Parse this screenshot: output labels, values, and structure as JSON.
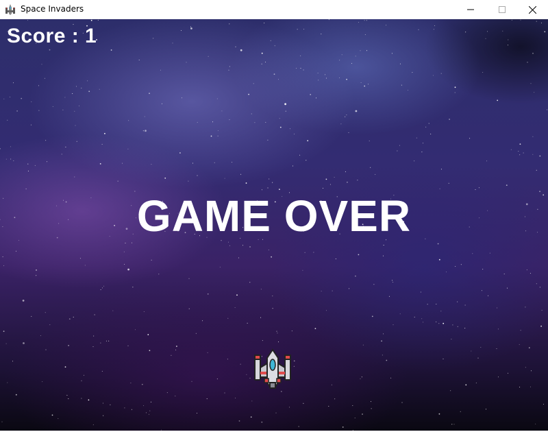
{
  "window": {
    "title": "Space Invaders",
    "app_icon": "space-invader-icon",
    "controls": [
      "minimize-icon",
      "maximize-icon",
      "close-icon"
    ]
  },
  "game": {
    "score_text": "Score : 1",
    "message": "GAME OVER",
    "player_icon": "spaceship-icon",
    "colors": {
      "text": "#ffffff",
      "sky_top": "#2d2e6b",
      "sky_mid": "#3a2266",
      "sky_bottom": "#0a0812"
    }
  }
}
